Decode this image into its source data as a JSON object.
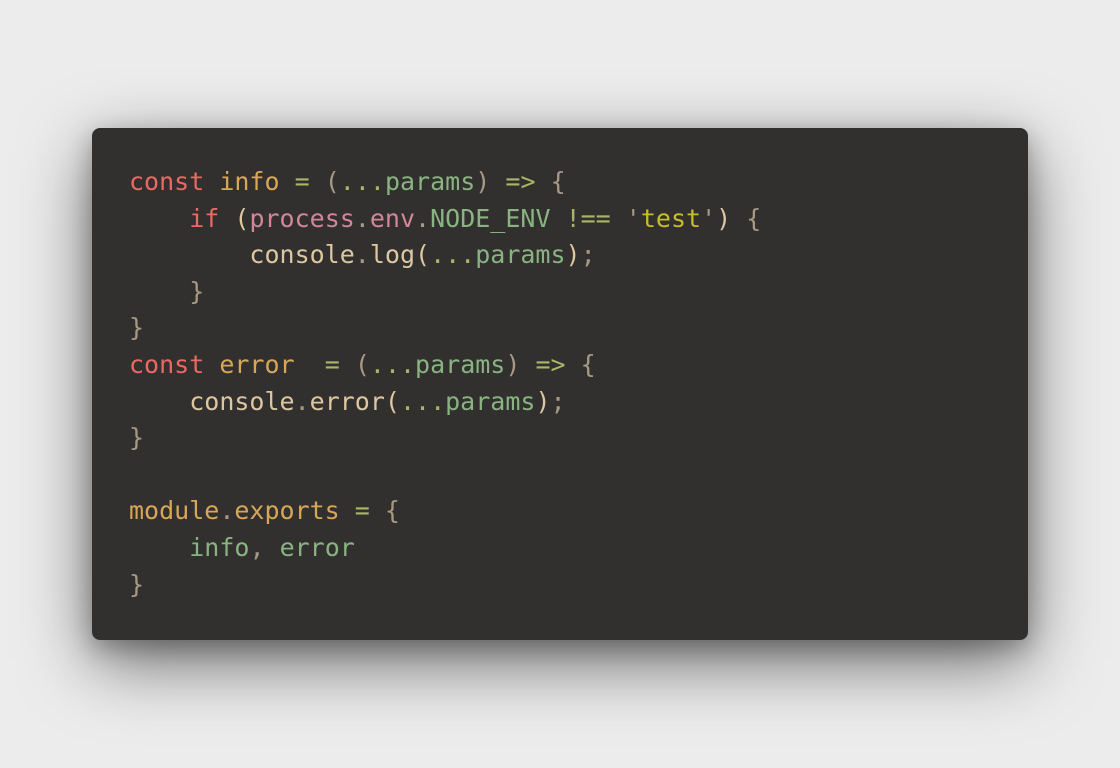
{
  "colors": {
    "background": "#ececec",
    "window": "#32302f",
    "keyword": "#ea6962",
    "identifier": "#d8a657",
    "variable": "#89b482",
    "punctuation": "#a89984",
    "operator": "#a9b665",
    "plain": "#ddc7a1",
    "string": "#c8be2a",
    "builtin": "#d3869b"
  },
  "code_lines": [
    [
      {
        "t": "const",
        "k": "keyword"
      },
      {
        "t": " "
      },
      {
        "t": "info",
        "k": "identifier"
      },
      {
        "t": " "
      },
      {
        "t": "=",
        "k": "operator"
      },
      {
        "t": " "
      },
      {
        "t": "(",
        "k": "punctuation"
      },
      {
        "t": "...",
        "k": "operator"
      },
      {
        "t": "params",
        "k": "variable"
      },
      {
        "t": ")",
        "k": "punctuation"
      },
      {
        "t": " "
      },
      {
        "t": "=>",
        "k": "operator"
      },
      {
        "t": " "
      },
      {
        "t": "{",
        "k": "punctuation"
      }
    ],
    [
      {
        "t": "    "
      },
      {
        "t": "if",
        "k": "keyword"
      },
      {
        "t": " "
      },
      {
        "t": "(",
        "k": "plain"
      },
      {
        "t": "process",
        "k": "builtin"
      },
      {
        "t": ".",
        "k": "punctuation"
      },
      {
        "t": "env",
        "k": "builtin"
      },
      {
        "t": ".",
        "k": "punctuation"
      },
      {
        "t": "NODE_ENV",
        "k": "variable"
      },
      {
        "t": " "
      },
      {
        "t": "!==",
        "k": "operator"
      },
      {
        "t": " "
      },
      {
        "t": "'",
        "k": "punctuation"
      },
      {
        "t": "test",
        "k": "string"
      },
      {
        "t": "'",
        "k": "punctuation"
      },
      {
        "t": ")",
        "k": "plain"
      },
      {
        "t": " "
      },
      {
        "t": "{",
        "k": "punctuation"
      }
    ],
    [
      {
        "t": "        "
      },
      {
        "t": "console",
        "k": "plain"
      },
      {
        "t": ".",
        "k": "punctuation"
      },
      {
        "t": "log",
        "k": "plain"
      },
      {
        "t": "(",
        "k": "plain"
      },
      {
        "t": "...",
        "k": "operator"
      },
      {
        "t": "params",
        "k": "variable"
      },
      {
        "t": ")",
        "k": "plain"
      },
      {
        "t": ";",
        "k": "punctuation"
      }
    ],
    [
      {
        "t": "    "
      },
      {
        "t": "}",
        "k": "punctuation"
      }
    ],
    [
      {
        "t": "}",
        "k": "punctuation"
      }
    ],
    [
      {
        "t": "const",
        "k": "keyword"
      },
      {
        "t": " "
      },
      {
        "t": "error",
        "k": "identifier"
      },
      {
        "t": "  "
      },
      {
        "t": "=",
        "k": "operator"
      },
      {
        "t": " "
      },
      {
        "t": "(",
        "k": "punctuation"
      },
      {
        "t": "...",
        "k": "operator"
      },
      {
        "t": "params",
        "k": "variable"
      },
      {
        "t": ")",
        "k": "punctuation"
      },
      {
        "t": " "
      },
      {
        "t": "=>",
        "k": "operator"
      },
      {
        "t": " "
      },
      {
        "t": "{",
        "k": "punctuation"
      }
    ],
    [
      {
        "t": "    "
      },
      {
        "t": "console",
        "k": "plain"
      },
      {
        "t": ".",
        "k": "punctuation"
      },
      {
        "t": "error",
        "k": "plain"
      },
      {
        "t": "(",
        "k": "plain"
      },
      {
        "t": "...",
        "k": "operator"
      },
      {
        "t": "params",
        "k": "variable"
      },
      {
        "t": ")",
        "k": "plain"
      },
      {
        "t": ";",
        "k": "punctuation"
      }
    ],
    [
      {
        "t": "}",
        "k": "punctuation"
      }
    ],
    [],
    [
      {
        "t": "module",
        "k": "identifier"
      },
      {
        "t": ".",
        "k": "punctuation"
      },
      {
        "t": "exports",
        "k": "identifier"
      },
      {
        "t": " "
      },
      {
        "t": "=",
        "k": "operator"
      },
      {
        "t": " "
      },
      {
        "t": "{",
        "k": "punctuation"
      }
    ],
    [
      {
        "t": "    "
      },
      {
        "t": "info",
        "k": "variable"
      },
      {
        "t": ",",
        "k": "punctuation"
      },
      {
        "t": " "
      },
      {
        "t": "error",
        "k": "variable"
      }
    ],
    [
      {
        "t": "}",
        "k": "punctuation"
      }
    ]
  ]
}
